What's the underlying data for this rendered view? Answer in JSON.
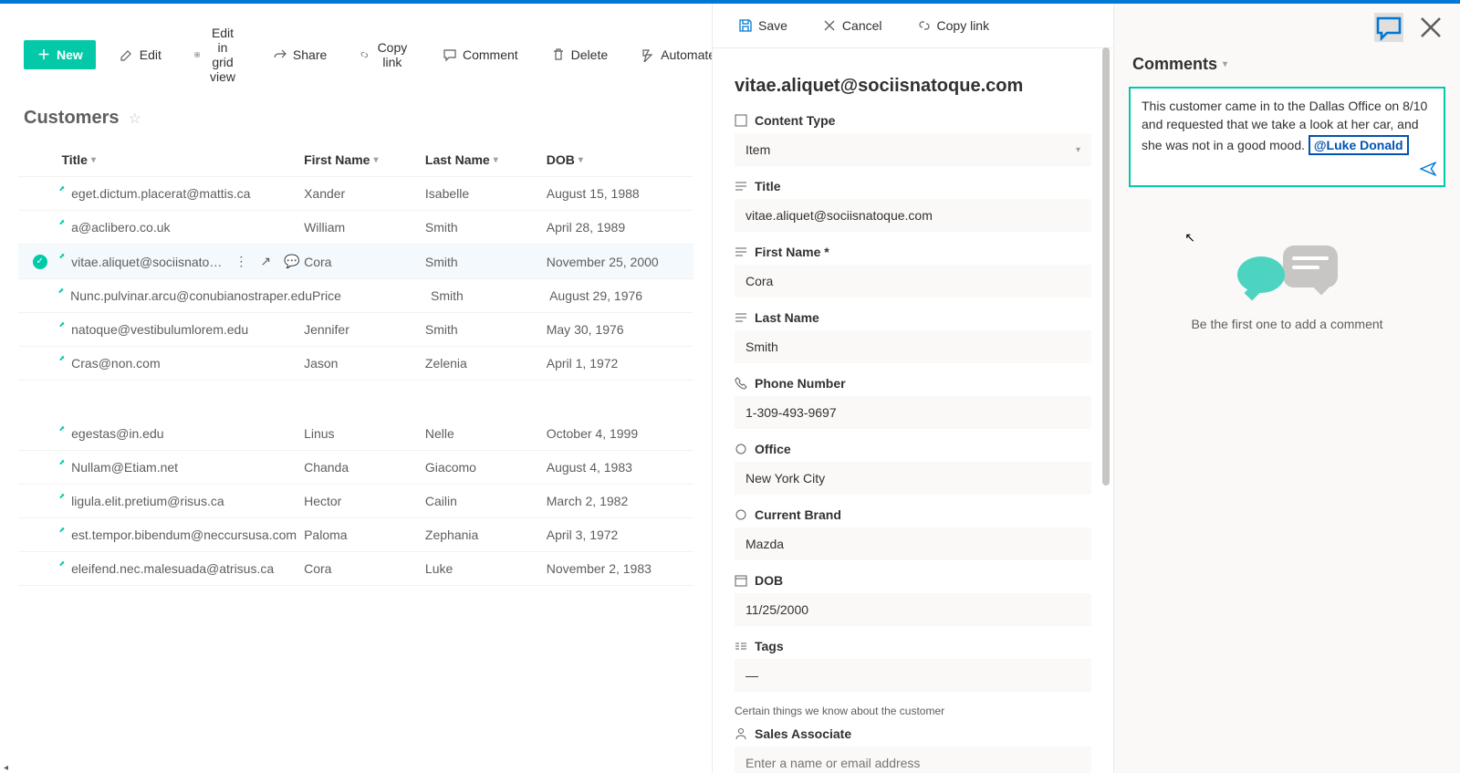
{
  "toolbar": {
    "new": "New",
    "edit": "Edit",
    "edit_grid": "Edit in grid view",
    "share": "Share",
    "copy_link": "Copy link",
    "comment": "Comment",
    "delete": "Delete",
    "automate": "Automate"
  },
  "list": {
    "title": "Customers",
    "columns": {
      "title": "Title",
      "first_name": "First Name",
      "last_name": "Last Name",
      "dob": "DOB"
    },
    "rows": [
      {
        "title": "eget.dictum.placerat@mattis.ca",
        "fn": "Xander",
        "ln": "Isabelle",
        "dob": "August 15, 1988"
      },
      {
        "title": "a@aclibero.co.uk",
        "fn": "William",
        "ln": "Smith",
        "dob": "April 28, 1989"
      },
      {
        "title": "vitae.aliquet@sociisnato…",
        "fn": "Cora",
        "ln": "Smith",
        "dob": "November 25, 2000",
        "selected": true
      },
      {
        "title": "Nunc.pulvinar.arcu@conubianostraper.edu",
        "fn": "Price",
        "ln": "Smith",
        "dob": "August 29, 1976"
      },
      {
        "title": "natoque@vestibulumlorem.edu",
        "fn": "Jennifer",
        "ln": "Smith",
        "dob": "May 30, 1976"
      },
      {
        "title": "Cras@non.com",
        "fn": "Jason",
        "ln": "Zelenia",
        "dob": "April 1, 1972"
      }
    ],
    "rows2": [
      {
        "title": "egestas@in.edu",
        "fn": "Linus",
        "ln": "Nelle",
        "dob": "October 4, 1999"
      },
      {
        "title": "Nullam@Etiam.net",
        "fn": "Chanda",
        "ln": "Giacomo",
        "dob": "August 4, 1983"
      },
      {
        "title": "ligula.elit.pretium@risus.ca",
        "fn": "Hector",
        "ln": "Cailin",
        "dob": "March 2, 1982"
      },
      {
        "title": "est.tempor.bibendum@neccursusa.com",
        "fn": "Paloma",
        "ln": "Zephania",
        "dob": "April 3, 1972"
      },
      {
        "title": "eleifend.nec.malesuada@atrisus.ca",
        "fn": "Cora",
        "ln": "Luke",
        "dob": "November 2, 1983"
      }
    ]
  },
  "panel": {
    "save": "Save",
    "cancel": "Cancel",
    "copy_link": "Copy link",
    "title": "vitae.aliquet@sociisnatoque.com",
    "fields": {
      "content_type": {
        "label": "Content Type",
        "value": "Item"
      },
      "title": {
        "label": "Title",
        "value": "vitae.aliquet@sociisnatoque.com"
      },
      "first_name": {
        "label": "First Name *",
        "value": "Cora"
      },
      "last_name": {
        "label": "Last Name",
        "value": "Smith"
      },
      "phone": {
        "label": "Phone Number",
        "value": "1-309-493-9697"
      },
      "office": {
        "label": "Office",
        "value": "New York City"
      },
      "brand": {
        "label": "Current Brand",
        "value": "Mazda"
      },
      "dob": {
        "label": "DOB",
        "value": "11/25/2000"
      },
      "tags": {
        "label": "Tags",
        "value": "—"
      },
      "tags_desc": "Certain things we know about the customer",
      "sales": {
        "label": "Sales Associate",
        "placeholder": "Enter a name or email address"
      }
    }
  },
  "comments": {
    "header": "Comments",
    "body": "This customer came in to the Dallas Office on 8/10 and requested that we take a look at her car, and she was not in a good mood.",
    "mention": "@Luke Donald",
    "empty": "Be the first one to add a comment"
  }
}
